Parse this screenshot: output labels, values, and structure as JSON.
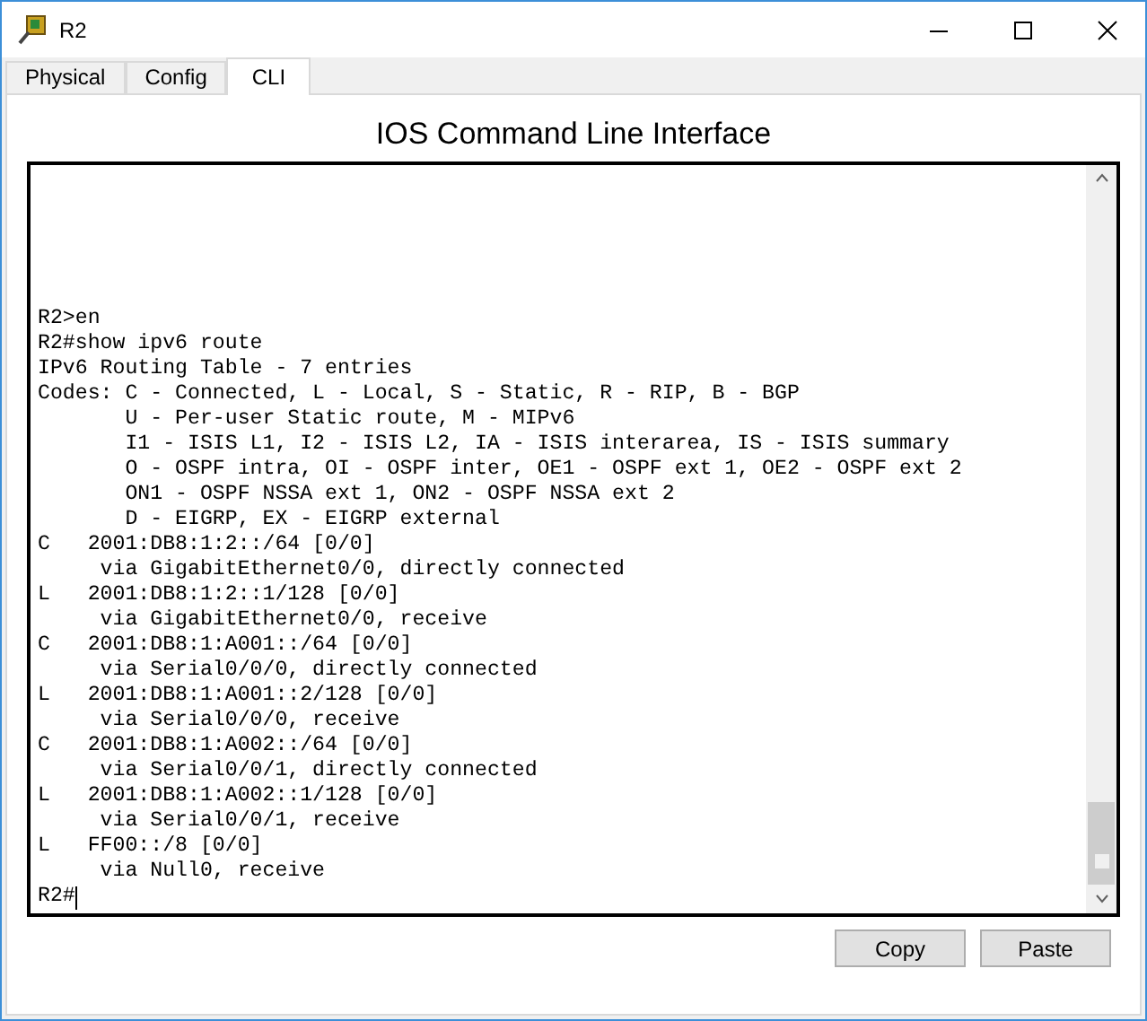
{
  "window": {
    "title": "R2"
  },
  "tabs": [
    {
      "label": "Physical",
      "selected": false
    },
    {
      "label": "Config",
      "selected": false
    },
    {
      "label": "CLI",
      "selected": true
    }
  ],
  "heading": "IOS Command Line Interface",
  "terminal": {
    "lines": [
      "R2>en",
      "R2#show ipv6 route",
      "IPv6 Routing Table - 7 entries",
      "Codes: C - Connected, L - Local, S - Static, R - RIP, B - BGP",
      "       U - Per-user Static route, M - MIPv6",
      "       I1 - ISIS L1, I2 - ISIS L2, IA - ISIS interarea, IS - ISIS summary",
      "       O - OSPF intra, OI - OSPF inter, OE1 - OSPF ext 1, OE2 - OSPF ext 2",
      "       ON1 - OSPF NSSA ext 1, ON2 - OSPF NSSA ext 2",
      "       D - EIGRP, EX - EIGRP external",
      "C   2001:DB8:1:2::/64 [0/0]",
      "     via GigabitEthernet0/0, directly connected",
      "L   2001:DB8:1:2::1/128 [0/0]",
      "     via GigabitEthernet0/0, receive",
      "C   2001:DB8:1:A001::/64 [0/0]",
      "     via Serial0/0/0, directly connected",
      "L   2001:DB8:1:A001::2/128 [0/0]",
      "     via Serial0/0/0, receive",
      "C   2001:DB8:1:A002::/64 [0/0]",
      "     via Serial0/0/1, directly connected",
      "L   2001:DB8:1:A002::1/128 [0/0]",
      "     via Serial0/0/1, receive",
      "L   FF00::/8 [0/0]",
      "     via Null0, receive"
    ],
    "prompt": "R2#"
  },
  "buttons": [
    "Copy",
    "Paste"
  ]
}
